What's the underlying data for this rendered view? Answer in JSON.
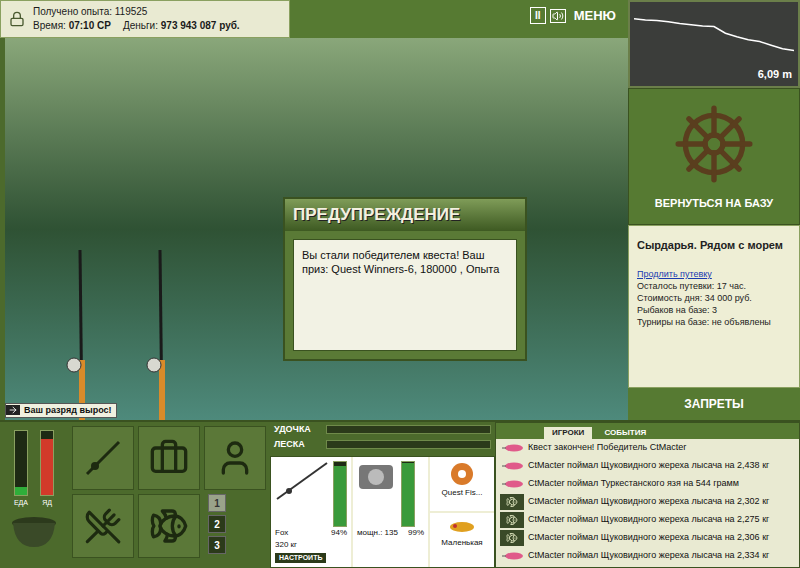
{
  "hud": {
    "experience_label": "Получено опыта:",
    "experience": "119525",
    "time_label": "Время:",
    "time": "07:10 СР",
    "money_label": "Деньги:",
    "money": "973 943 087 руб."
  },
  "top_buttons": [
    {
      "label": "II"
    },
    {
      "label": "МЕНЮ"
    }
  ],
  "depth_chart": {
    "values": [
      0.8,
      1.0,
      1.1,
      1.3,
      1.6,
      1.8,
      2.0,
      2.1,
      3.2,
      3.8,
      4.3,
      4.6,
      5.2,
      5.8,
      6.09
    ],
    "reading": "6,09 m"
  },
  "dialog": {
    "title": "ПРЕДУПРЕЖДЕНИЕ",
    "message": "Вы стали победителем квеста! Ваш приз: Quest Winners-6, 180000 , Опыта"
  },
  "notice": "Ваш разряд вырос!",
  "base": {
    "button": "ВЕРНУТЬСЯ НА БАЗУ",
    "place": "Сырдарья. Рядом с морем",
    "link": "Продлить путевку",
    "stats": [
      "Осталось путевки: 17 час.",
      "Стоимость дня: 34 000 руб.",
      "Рыбаков на базе: 3",
      "Турниры на базе: не объявлены"
    ],
    "bans": "ЗАПРЕТЫ"
  },
  "needs": [
    {
      "label": "ЕДА",
      "level": 0.12,
      "color": "#2fae3a"
    },
    {
      "label": "ЯД",
      "level": 0.88,
      "color": "#d23a2a"
    }
  ],
  "tension": [
    {
      "label": "УДОЧКА",
      "level": 0
    },
    {
      "label": "ЛЕСКА",
      "level": 0
    }
  ],
  "rod": {
    "name": "Fox",
    "strength": "320 кг",
    "reading": "94%",
    "level": 0.94,
    "button": "НАСТРОИТЬ"
  },
  "reel": {
    "power": "мощн.: 135",
    "reading": "99%",
    "level": 0.99
  },
  "line": {
    "name": "Quest Fis..."
  },
  "lure": {
    "name": "Маленькая"
  },
  "tackle_sets": [
    {
      "label": "1",
      "selected": true
    },
    {
      "label": "2",
      "selected": false
    },
    {
      "label": "3",
      "selected": false
    }
  ],
  "events_tabs": [
    {
      "label": "ИГРОКИ",
      "selected": true
    },
    {
      "label": "СОБЫТИЯ",
      "selected": false
    }
  ],
  "events": [
    {
      "kind": "lure",
      "text": "Квест закончен! Победитель CtMacter"
    },
    {
      "kind": "lure",
      "text": "CtMacter поймал Щуковидного жереха лысача на 2,438 кг"
    },
    {
      "kind": "lure",
      "text": "CtMacter поймал Туркестанского язя на 544 грамм"
    },
    {
      "kind": "fish",
      "text": "CtMacter поймал Щуковидного жереха лысача на 2,302 кг"
    },
    {
      "kind": "fish",
      "text": "CtMacter поймал Щуковидного жереха лысача на 2,275 кг"
    },
    {
      "kind": "fish",
      "text": "CtMacter поймал Щуковидного жереха лысача на 2,306 кг"
    },
    {
      "kind": "lure",
      "text": "CtMacter поймал Щуковидного жереха лысача на 2,334 кг"
    }
  ]
}
